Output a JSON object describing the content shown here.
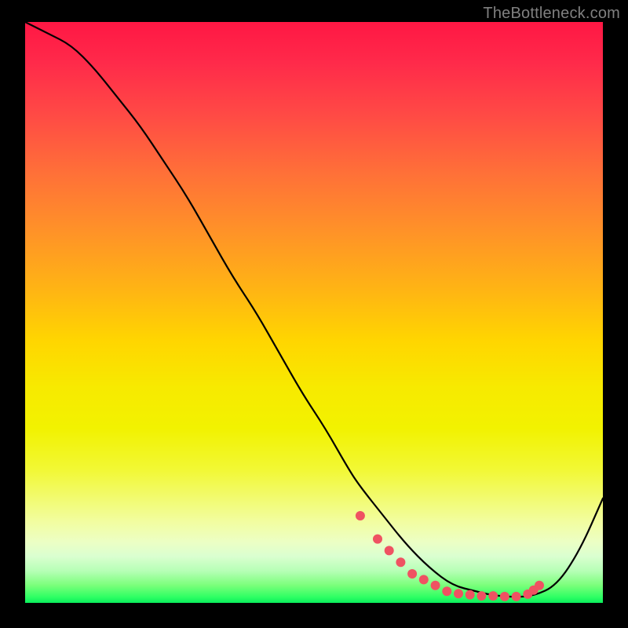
{
  "watermark": "TheBottleneck.com",
  "chart_data": {
    "type": "line",
    "title": "",
    "xlabel": "",
    "ylabel": "",
    "xlim": [
      0,
      100
    ],
    "ylim": [
      0,
      100
    ],
    "series": [
      {
        "name": "curve",
        "x": [
          0,
          4,
          8,
          12,
          16,
          20,
          24,
          28,
          32,
          36,
          40,
          44,
          48,
          52,
          56,
          58,
          62,
          66,
          70,
          74,
          78,
          80,
          82,
          85,
          88,
          92,
          96,
          100
        ],
        "values": [
          100,
          98,
          96,
          92,
          87,
          82,
          76,
          70,
          63,
          56,
          50,
          43,
          36,
          30,
          23,
          20,
          15,
          10,
          6,
          3,
          2,
          1.5,
          1.2,
          1.0,
          1.2,
          3,
          9,
          18
        ]
      },
      {
        "name": "markers",
        "x": [
          58,
          61,
          63,
          65,
          67,
          69,
          71,
          73,
          75,
          77,
          79,
          81,
          83,
          85,
          87,
          88,
          89
        ],
        "values": [
          15,
          11,
          9,
          7,
          5,
          4,
          3,
          2,
          1.6,
          1.4,
          1.2,
          1.2,
          1.1,
          1.1,
          1.5,
          2.2,
          3.0
        ]
      }
    ],
    "colors": {
      "curve": "#000000",
      "marker": "#ef5262",
      "gradient_top": "#ff1744",
      "gradient_mid": "#ffea00",
      "gradient_bottom": "#0aee5b"
    }
  }
}
